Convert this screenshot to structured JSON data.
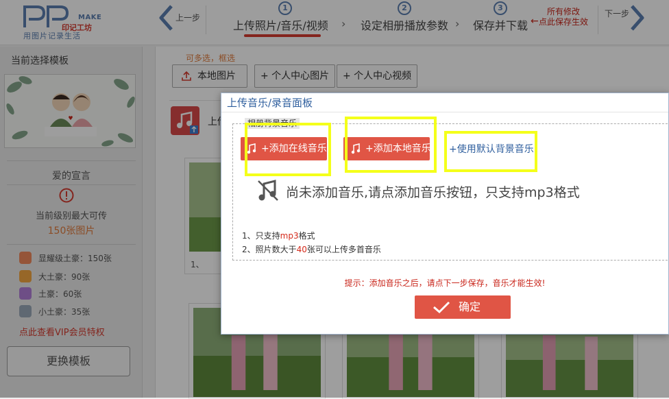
{
  "header": {
    "logo_make": "MAKE",
    "logo_brand": "印记工坊",
    "logo_slogan": "用图片记录生活",
    "prev_label": "上一步",
    "next_label": "下一步",
    "steps": [
      {
        "num": "1",
        "label": "上传照片/音乐/视频"
      },
      {
        "num": "2",
        "label": "设定相册播放参数"
      },
      {
        "num": "3",
        "label": "保存并下载"
      }
    ],
    "save_tip": [
      "所有修改",
      "点此保存生效"
    ]
  },
  "sidebar": {
    "title": "当前选择模板",
    "template_name": "爱的宣言",
    "level_text": "当前级别最大可传",
    "max_text": "150张图片",
    "vip_levels": [
      {
        "label": "显耀级土豪：150张",
        "color": "#f08a5d"
      },
      {
        "label": "大土豪：90张",
        "color": "#f4a742"
      },
      {
        "label": "土豪：60张",
        "color": "#b27fd8"
      },
      {
        "label": "小土豪：35张",
        "color": "#9aa8b8"
      }
    ],
    "vip_link": "点此查看VIP会员特权",
    "change_template": "更换模板"
  },
  "main": {
    "multi_hint": "可多选，框选",
    "buttons": {
      "local_image": "本地图片",
      "center_image": "+ 个人中心图片",
      "center_video": "+ 个人中心视频"
    },
    "upload_label": "上传",
    "card_number": "1、"
  },
  "modal": {
    "title": "上传音乐/录音面板",
    "legend": "相册背景音乐",
    "add_online": "+添加在线音乐",
    "add_local": "+添加本地音乐",
    "use_default": "+使用默认背景音乐",
    "empty_message": "尚未添加音乐,请点添加音乐按钮，只支持mp3格式",
    "rule1": {
      "prefix": "1、只支持",
      "highlight": "mp3",
      "suffix": "格式"
    },
    "rule2": {
      "prefix": "2、照片数大于",
      "highlight": "40",
      "suffix": "张可以上传多首音乐"
    },
    "tip": "提示：添加音乐之后，请点下一步保存，音乐才能生效!",
    "confirm": "确定"
  },
  "colors": {
    "accent_red": "#e05545",
    "brand_blue": "#2f5f9e",
    "highlight_yellow": "#f4ff1a"
  }
}
